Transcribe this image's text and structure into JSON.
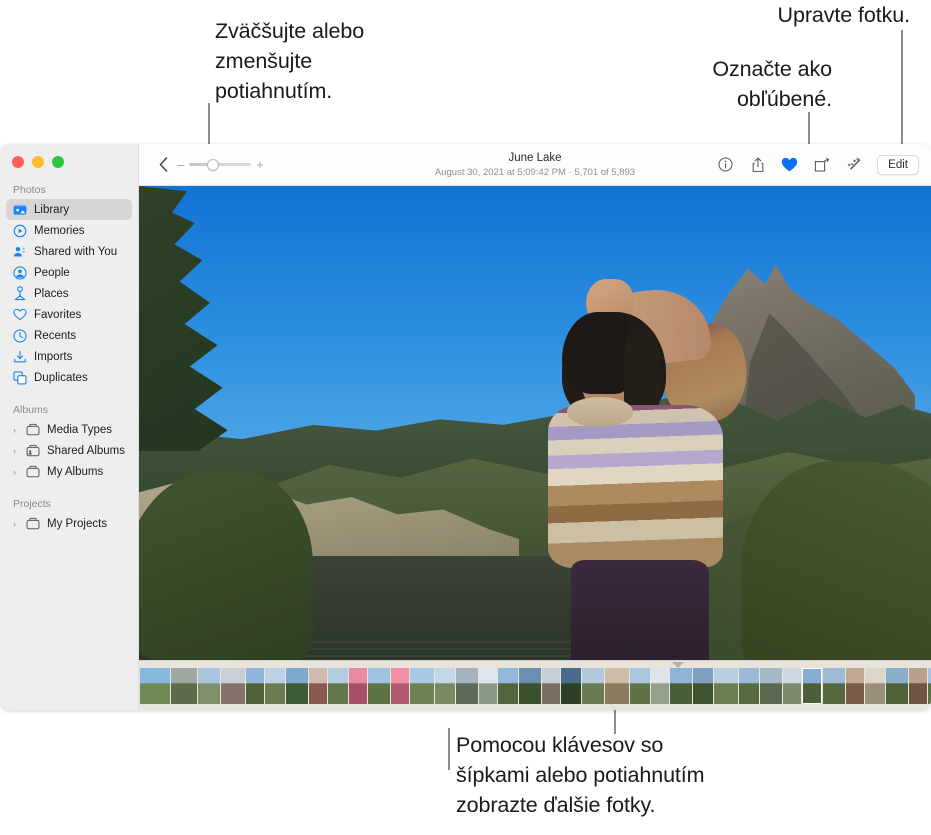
{
  "annotations": {
    "zoom_hint": "Zväčšujte alebo\nzmenšujte\npotiahnutím.",
    "favorite_hint": "Označte ako\nobľúbené.",
    "edit_hint": "Upravte fotku.",
    "arrows_hint": "Pomocou klávesov so\nšípkami alebo potiahnutím\nzobrazte ďalšie fotky."
  },
  "window": {
    "traffic_lights": [
      {
        "name": "close",
        "color": "#ff5f57"
      },
      {
        "name": "minimize",
        "color": "#febc2e"
      },
      {
        "name": "zoom",
        "color": "#28c840"
      }
    ]
  },
  "sidebar": {
    "sections": [
      {
        "header": "Photos",
        "items": [
          {
            "label": "Library",
            "icon": "library-icon",
            "selected": true
          },
          {
            "label": "Memories",
            "icon": "memories-icon",
            "selected": false
          },
          {
            "label": "Shared with You",
            "icon": "shared-with-you-icon",
            "selected": false
          },
          {
            "label": "People",
            "icon": "people-icon",
            "selected": false
          },
          {
            "label": "Places",
            "icon": "places-icon",
            "selected": false
          },
          {
            "label": "Favorites",
            "icon": "heart-outline-icon",
            "selected": false
          },
          {
            "label": "Recents",
            "icon": "clock-icon",
            "selected": false
          },
          {
            "label": "Imports",
            "icon": "import-icon",
            "selected": false
          },
          {
            "label": "Duplicates",
            "icon": "duplicates-icon",
            "selected": false
          }
        ]
      },
      {
        "header": "Albums",
        "items": [
          {
            "label": "Media Types",
            "icon": "album-icon",
            "selected": false,
            "disclosure": "›"
          },
          {
            "label": "Shared Albums",
            "icon": "shared-album-icon",
            "selected": false,
            "disclosure": "›"
          },
          {
            "label": "My Albums",
            "icon": "album-icon",
            "selected": false,
            "disclosure": "›"
          }
        ]
      },
      {
        "header": "Projects",
        "items": [
          {
            "label": "My Projects",
            "icon": "album-icon",
            "selected": false,
            "disclosure": "›"
          }
        ]
      }
    ]
  },
  "toolbar": {
    "back_icon": "chevron-left-icon",
    "zoom_slider": {
      "minus_label": "–",
      "plus_label": "+",
      "value_percent": 38
    },
    "photo_title": "June Lake",
    "photo_subtitle": "August 30, 2021 at 5:09:42 PM  ·  5,701 of 5,893",
    "actions": [
      {
        "name": "info-icon",
        "label": "Info"
      },
      {
        "name": "share-icon",
        "label": "Share"
      },
      {
        "name": "heart-filled-icon",
        "label": "Favorite",
        "active": true,
        "color": "#0a6ff0"
      },
      {
        "name": "rotate-icon",
        "label": "Rotate"
      },
      {
        "name": "auto-enhance-icon",
        "label": "Auto Enhance"
      }
    ],
    "edit_label": "Edit"
  },
  "filmstrip": {
    "caret_icon": "caret-down-icon",
    "thumbs": [
      {
        "w": 30,
        "c1": "#87b8dd",
        "c2": "#6d8a54"
      },
      {
        "w": 26,
        "c1": "#9fa9a2",
        "c2": "#5d6b4d"
      },
      {
        "w": 22,
        "c1": "#a8c4de",
        "c2": "#7e8f6c"
      },
      {
        "w": 24,
        "c1": "#c9cfd4",
        "c2": "#85736a"
      },
      {
        "w": 18,
        "c1": "#8fb6d8",
        "c2": "#4e6239"
      },
      {
        "w": 20,
        "c1": "#bcd2e4",
        "c2": "#6b7c55"
      },
      {
        "w": 22,
        "c1": "#7fa8cf",
        "c2": "#3f5a36"
      },
      {
        "w": 18,
        "c1": "#d0b9b0",
        "c2": "#8a5a52"
      },
      {
        "w": 20,
        "c1": "#b5cde0",
        "c2": "#63754c"
      },
      {
        "w": 18,
        "c1": "#e88aa0",
        "c2": "#a74f66"
      },
      {
        "w": 22,
        "c1": "#9dc3e0",
        "c2": "#5f7347"
      },
      {
        "w": 18,
        "c1": "#f08fa6",
        "c2": "#b05a70"
      },
      {
        "w": 24,
        "c1": "#a7c9e3",
        "c2": "#6e8253"
      },
      {
        "w": 20,
        "c1": "#c2d6e6",
        "c2": "#7a8a60"
      },
      {
        "w": 22,
        "c1": "#a4b3bd",
        "c2": "#5c6a58"
      },
      {
        "w": 18,
        "c1": "#dfe6eb",
        "c2": "#8b9a85"
      },
      {
        "w": 20,
        "c1": "#93b9da",
        "c2": "#4f6640"
      },
      {
        "w": 22,
        "c1": "#6c8faf",
        "c2": "#3a5130"
      },
      {
        "w": 18,
        "c1": "#c7cfd6",
        "c2": "#7c6f62"
      },
      {
        "w": 20,
        "c1": "#4a6b8c",
        "c2": "#2d4026"
      },
      {
        "w": 22,
        "c1": "#b3c8d8",
        "c2": "#6a7a55"
      },
      {
        "w": 24,
        "c1": "#cdbda6",
        "c2": "#8a7a5e"
      },
      {
        "w": 20,
        "c1": "#aac6de",
        "c2": "#5e7346"
      },
      {
        "w": 18,
        "c1": "#dde3e8",
        "c2": "#93a08c"
      },
      {
        "w": 22,
        "c1": "#8fb5d6",
        "c2": "#48603a"
      },
      {
        "w": 20,
        "c1": "#7d9fc0",
        "c2": "#3d5431"
      },
      {
        "w": 24,
        "c1": "#b9cfe0",
        "c2": "#6c7f52"
      },
      {
        "w": 20,
        "c1": "#9cbad6",
        "c2": "#566b42"
      },
      {
        "w": 22,
        "c1": "#a3b9c9",
        "c2": "#5a6a4e"
      },
      {
        "w": 18,
        "c1": "#cdd8e0",
        "c2": "#7d8a6e"
      },
      {
        "w": 20,
        "c1": "#87aed0",
        "c2": "#4a5f3a",
        "current": true
      },
      {
        "w": 22,
        "c1": "#9ebbd5",
        "c2": "#55693f"
      },
      {
        "w": 18,
        "c1": "#c0a893",
        "c2": "#7a5c4a"
      },
      {
        "w": 20,
        "c1": "#dcd6cb",
        "c2": "#9b8f7c"
      },
      {
        "w": 22,
        "c1": "#8aaec9",
        "c2": "#4d6238"
      },
      {
        "w": 18,
        "c1": "#b8a08c",
        "c2": "#6f5443"
      },
      {
        "w": 20,
        "c1": "#a6c2da",
        "c2": "#5b7044"
      },
      {
        "w": 22,
        "c1": "#93b4d2",
        "c2": "#4f6539"
      },
      {
        "w": 18,
        "c1": "#6d5f56",
        "c2": "#3a3029"
      },
      {
        "w": 20,
        "c1": "#b0c8dc",
        "c2": "#627548"
      },
      {
        "w": 22,
        "c1": "#9db6cb",
        "c2": "#566849"
      },
      {
        "w": 18,
        "c1": "#d8c9b4",
        "c2": "#9a8768"
      },
      {
        "w": 20,
        "c1": "#8fb2d4",
        "c2": "#4b6137"
      },
      {
        "w": 22,
        "c1": "#5a7c9e",
        "c2": "#2f4428"
      },
      {
        "w": 18,
        "c1": "#c5d3de",
        "c2": "#76856a"
      },
      {
        "w": 20,
        "c1": "#a1bdd8",
        "c2": "#586d42"
      },
      {
        "w": 22,
        "c1": "#2e3840",
        "c2": "#15191d"
      },
      {
        "w": 18,
        "c1": "#e0a7b6",
        "c2": "#a96d7e"
      },
      {
        "w": 20,
        "c1": "#cbb9a4",
        "c2": "#8a7560"
      },
      {
        "w": 22,
        "c1": "#dfdad2",
        "c2": "#a09a90"
      },
      {
        "w": 18,
        "c1": "#aebfc9",
        "c2": "#6d7a74"
      },
      {
        "w": 20,
        "c1": "#c9d2d8",
        "c2": "#7e8a86"
      },
      {
        "w": 22,
        "c1": "#9aa8b4",
        "c2": "#5d6a70"
      },
      {
        "w": 18,
        "c1": "#bfc8cf",
        "c2": "#75807f"
      },
      {
        "w": 20,
        "c1": "#8c9aa6",
        "c2": "#4f5a5f"
      },
      {
        "w": 22,
        "c1": "#d3cfc8",
        "c2": "#94908a"
      }
    ]
  }
}
